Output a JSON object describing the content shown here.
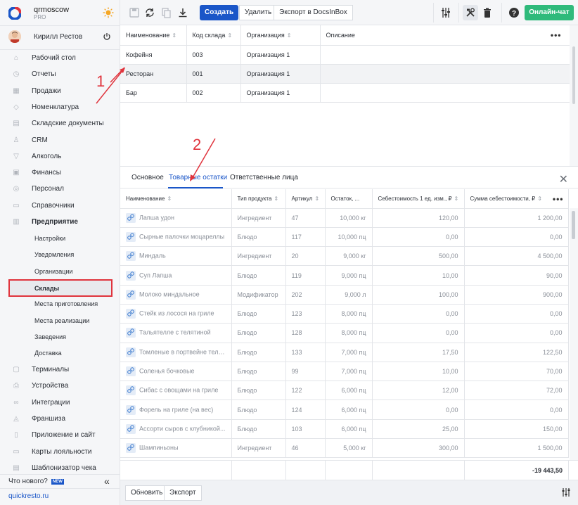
{
  "brand": {
    "name": "qrmoscow",
    "plan": "PRO"
  },
  "user": {
    "name": "Кирилл Рестов"
  },
  "nav": [
    {
      "label": "Рабочий стол",
      "icon": "dashboard-icon"
    },
    {
      "label": "Отчеты",
      "icon": "reports-icon"
    },
    {
      "label": "Продажи",
      "icon": "sales-icon"
    },
    {
      "label": "Номенклатура",
      "icon": "tag-icon"
    },
    {
      "label": "Складские документы",
      "icon": "documents-icon"
    },
    {
      "label": "CRM",
      "icon": "crm-icon"
    },
    {
      "label": "Алкоголь",
      "icon": "glass-icon"
    },
    {
      "label": "Финансы",
      "icon": "wallet-icon"
    },
    {
      "label": "Персонал",
      "icon": "person-icon"
    },
    {
      "label": "Справочники",
      "icon": "book-icon"
    },
    {
      "label": "Предприятие",
      "icon": "building-icon"
    }
  ],
  "subnav": [
    {
      "label": "Настройки"
    },
    {
      "label": "Уведомления"
    },
    {
      "label": "Организации"
    },
    {
      "label": "Склады"
    },
    {
      "label": "Места приготовления"
    },
    {
      "label": "Места реализации"
    },
    {
      "label": "Заведения"
    },
    {
      "label": "Доставка"
    }
  ],
  "nav2": [
    {
      "label": "Терминалы",
      "icon": "terminal-icon"
    },
    {
      "label": "Устройства",
      "icon": "printer-icon"
    },
    {
      "label": "Интеграции",
      "icon": "link-icon"
    },
    {
      "label": "Франшиза",
      "icon": "franchise-icon"
    },
    {
      "label": "Приложение и сайт",
      "icon": "app-icon"
    },
    {
      "label": "Карты лояльности",
      "icon": "card-icon"
    },
    {
      "label": "Шаблонизатор чека",
      "icon": "receipt-icon"
    }
  ],
  "sidebar_footer": {
    "news": "Что нового?",
    "news_badge": "NEW",
    "site": "quickresto.ru"
  },
  "toolbar": {
    "create": "Создать",
    "delete": "Удалить",
    "export": "Экспорт в DocsInBox",
    "chat": "Онлайн-чат"
  },
  "top_table": {
    "headers": [
      "Наименование",
      "Код склада",
      "Организация",
      "Описание"
    ],
    "rows": [
      [
        "Кофейня",
        "003",
        "Организация 1",
        ""
      ],
      [
        "Ресторан",
        "001",
        "Организация 1",
        ""
      ],
      [
        "Бар",
        "002",
        "Организация 1",
        ""
      ]
    ]
  },
  "tabs": [
    "Основное",
    "Товарные остатки",
    "Ответственные лица"
  ],
  "grid": {
    "headers": [
      "Наименование",
      "Тип продукта",
      "Артикул",
      "Остаток, ...",
      "Себестоимость 1 ед. изм., ₽",
      "Сумма себестоимости, ₽"
    ],
    "rows": [
      [
        "Лапша удон",
        "Ингредиент",
        "47",
        "10,000 кг",
        "120,00",
        "1 200,00"
      ],
      [
        "Сырные палочки моцареллы",
        "Блюдо",
        "117",
        "10,000 пц",
        "0,00",
        "0,00"
      ],
      [
        "Миндаль",
        "Ингредиент",
        "20",
        "9,000 кг",
        "500,00",
        "4 500,00"
      ],
      [
        "Суп Лапша",
        "Блюдо",
        "119",
        "9,000 пц",
        "10,00",
        "90,00"
      ],
      [
        "Молоко миндальное",
        "Модификатор",
        "202",
        "9,000 л",
        "100,00",
        "900,00"
      ],
      [
        "Стейк из лосося на гриле",
        "Блюдо",
        "123",
        "8,000 пц",
        "0,00",
        "0,00"
      ],
      [
        "Тальятелле с телятиной",
        "Блюдо",
        "128",
        "8,000 пц",
        "0,00",
        "0,00"
      ],
      [
        "Томленые в портвейне теля...",
        "Блюдо",
        "133",
        "7,000 пц",
        "17,50",
        "122,50"
      ],
      [
        "Соленья бочковые",
        "Блюдо",
        "99",
        "7,000 пц",
        "10,00",
        "70,00"
      ],
      [
        "Сибас с овощами на гриле",
        "Блюдо",
        "122",
        "6,000 пц",
        "12,00",
        "72,00"
      ],
      [
        "Форель на гриле (на вес)",
        "Блюдо",
        "124",
        "6,000 пц",
        "0,00",
        "0,00"
      ],
      [
        "Ассорти сыров с клубникой...",
        "Блюдо",
        "103",
        "6,000 пц",
        "25,00",
        "150,00"
      ],
      [
        "Шампиньоны",
        "Ингредиент",
        "46",
        "5,000 кг",
        "300,00",
        "1 500,00"
      ]
    ],
    "total": "-19 443,50"
  },
  "footer": {
    "refresh": "Обновить",
    "export": "Экспорт"
  },
  "annotations": [
    "1",
    "2"
  ],
  "colors": {
    "accent": "#1a56c8",
    "chat": "#2fba7b",
    "annotation": "#e0343d"
  }
}
